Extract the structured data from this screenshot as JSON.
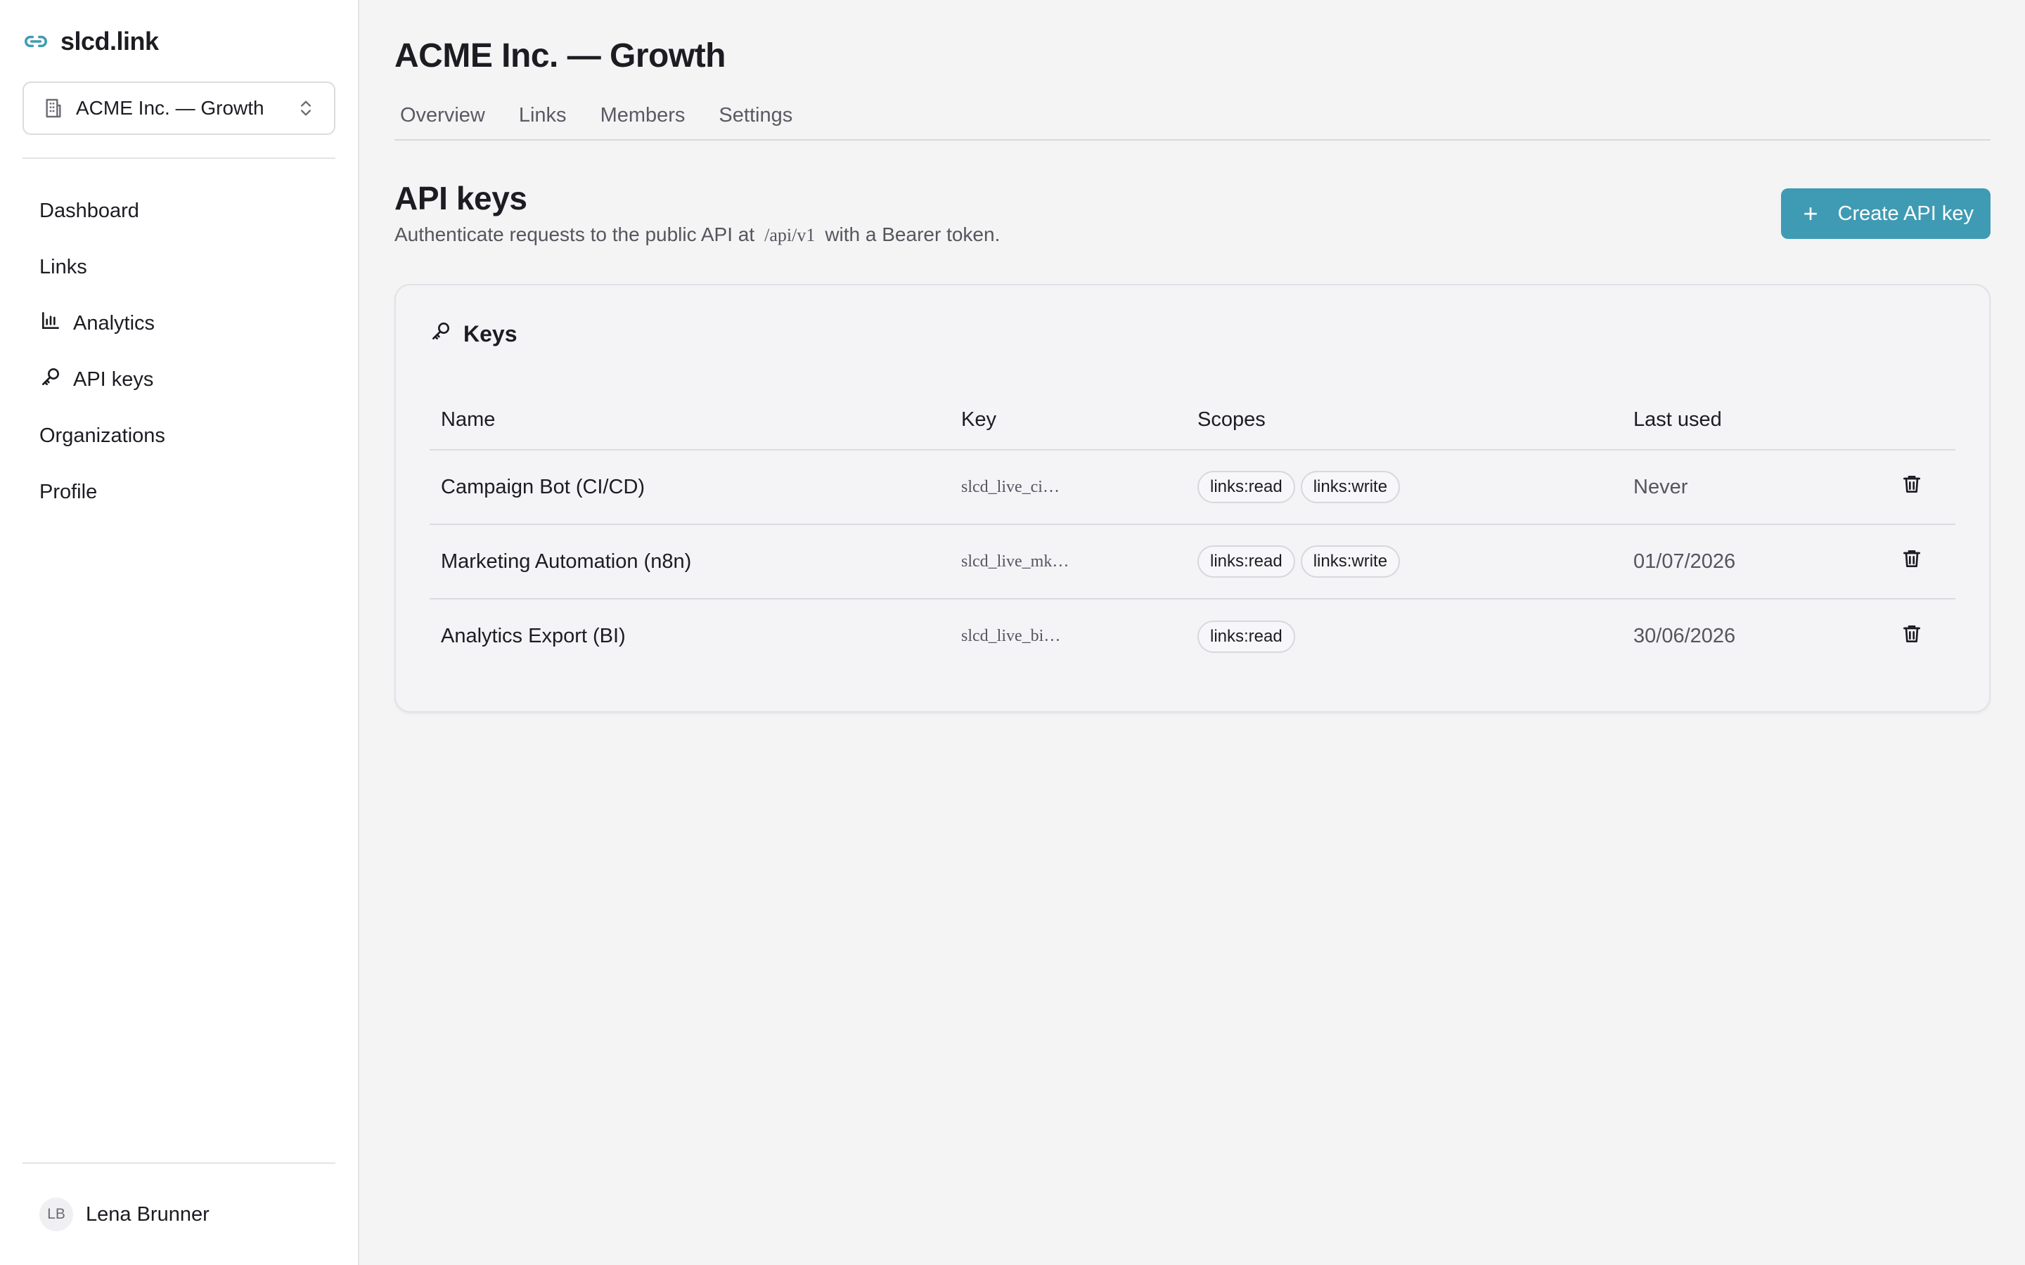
{
  "brand": {
    "name": "slcd.link",
    "icon": "link-icon",
    "accent": "#3f9bb3"
  },
  "org_switcher": {
    "value": "ACME Inc. — Growth",
    "icon": "building-icon"
  },
  "sidebar": {
    "items": [
      {
        "label": "Dashboard",
        "icon": ""
      },
      {
        "label": "Links",
        "icon": ""
      },
      {
        "label": "Analytics",
        "icon": "bar-chart-icon"
      },
      {
        "label": "API keys",
        "icon": "key-icon"
      },
      {
        "label": "Organizations",
        "icon": ""
      },
      {
        "label": "Profile",
        "icon": ""
      }
    ]
  },
  "user": {
    "initials": "LB",
    "name": "Lena Brunner"
  },
  "header": {
    "title": "ACME Inc. — Growth",
    "tabs": [
      {
        "label": "Overview"
      },
      {
        "label": "Links"
      },
      {
        "label": "Members"
      },
      {
        "label": "Settings"
      }
    ]
  },
  "section": {
    "title": "API keys",
    "desc_before": "Authenticate requests to the public API at",
    "desc_code": "/api/v1",
    "desc_after": "with a Bearer token.",
    "create_label": "Create API key"
  },
  "card": {
    "title": "Keys",
    "columns": [
      "Name",
      "Key",
      "Scopes",
      "Last used"
    ],
    "rows": [
      {
        "name": "Campaign Bot (CI/CD)",
        "key": "slcd_live_ci…",
        "scopes": [
          "links:read",
          "links:write"
        ],
        "last_used": "Never"
      },
      {
        "name": "Marketing Automation (n8n)",
        "key": "slcd_live_mk…",
        "scopes": [
          "links:read",
          "links:write"
        ],
        "last_used": "01/07/2026"
      },
      {
        "name": "Analytics Export (BI)",
        "key": "slcd_live_bi…",
        "scopes": [
          "links:read"
        ],
        "last_used": "30/06/2026"
      }
    ]
  }
}
